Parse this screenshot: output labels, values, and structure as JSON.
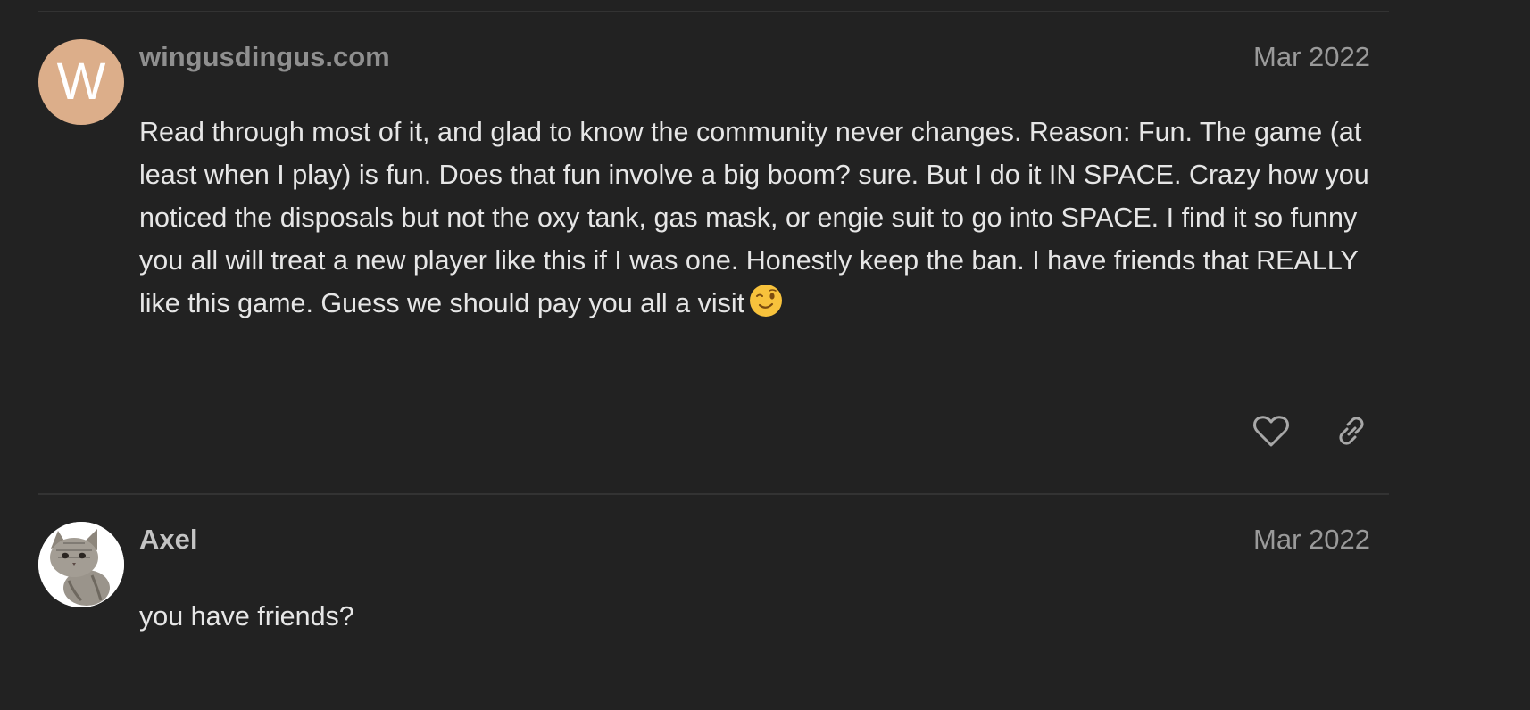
{
  "posts": [
    {
      "avatar_letter": "W",
      "avatar_color": "#dcae8a",
      "username": "wingusdingus.com",
      "date": "Mar 2022",
      "text": "Read through most of it, and glad to know the community never changes. Reason: Fun. The game (at least when I play) is fun. Does that fun involve a big boom? sure. But I do it IN SPACE. Crazy how you noticed the disposals but not the oxy tank, gas mask, or engie suit to go into SPACE. I find it so funny you all will treat a new player like this if I was one. Honestly keep the ban. I have friends that REALLY like this game. Guess we should pay you all a visit",
      "emoji": "winking-face-emoji",
      "actions": [
        "heart-icon",
        "link-icon"
      ]
    },
    {
      "avatar": "kitten-photo",
      "username": "Axel",
      "date": "Mar 2022",
      "text": "you have friends?"
    }
  ],
  "colors": {
    "background": "#222222",
    "divider": "#333333",
    "text": "#e6e6e6",
    "muted": "#9a9a9a"
  }
}
